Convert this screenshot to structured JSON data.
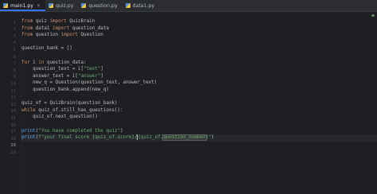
{
  "tabs": [
    {
      "label": "main1.py",
      "active": true
    },
    {
      "label": "quiz.py",
      "active": false
    },
    {
      "label": "question.py",
      "active": false
    },
    {
      "label": "data1.py",
      "active": false
    }
  ],
  "line_numbers": [
    "1",
    "2",
    "3",
    "4",
    "5",
    "6",
    "7",
    "8",
    "9",
    "10",
    "11",
    "12",
    "13",
    "14",
    "15",
    "16",
    "17",
    "18",
    "19",
    "20"
  ],
  "code_text": {
    "l2a": "from",
    "l2b": " quiz ",
    "l2c": "import",
    "l2d": " QuizBrain",
    "l3a": "from",
    "l3b": " data1 ",
    "l3c": "import",
    "l3d": " question_data",
    "l4a": "from",
    "l4b": " question ",
    "l4c": "import",
    "l4d": " Question",
    "l6": "question_bank = []",
    "l8a": "for",
    "l8b": " i ",
    "l8c": "in",
    "l8d": " question_data:",
    "l9a": "    question_text = i[",
    "l9b": "\"text\"",
    "l9c": "]",
    "l10a": "    answer_text = i[",
    "l10b": "\"answer\"",
    "l10c": "]",
    "l11": "    new_q = Question(question_text, answer_text)",
    "l12": "    question_bank.append(new_q)",
    "l14": "quiz_of = QuizBrain(question_bank)",
    "l15a": "while",
    "l15b": " quiz_of.still_has_questions():",
    "l16": "    quiz_of.next_question()",
    "l18a": "print",
    "l18b": "(",
    "l18c": "\"You have completed the quiz\"",
    "l18d": ")",
    "l19a": "print",
    "l19b": "(",
    "l19c": "f\"your final score {quiz_of.score}/",
    "l19d": "{quiz_of.",
    "l19e": "question_number",
    "l19f": "}\"",
    "l19g": ")"
  },
  "colors": {
    "background": "#1e1f22",
    "keyword": "#cf8e6d",
    "string": "#6aab73",
    "function": "#56a8f5",
    "text": "#bcbec4",
    "accent": "#3574f0"
  }
}
